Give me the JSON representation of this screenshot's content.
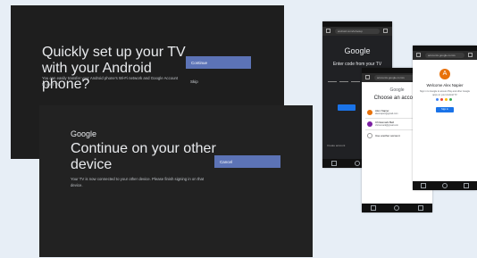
{
  "tv_setup": {
    "title": "Quickly set up your TV with your Android phone?",
    "description": "You can easily transfer your Android phone's Wi-Fi network and Google Account to your TV",
    "continue_label": "Continue",
    "skip_label": "Skip"
  },
  "tv_continue": {
    "brand": "Google",
    "title": "Continue on your other device",
    "description": "Your TV is now connected to your other device. Please finish signing in on that device.",
    "cancel_label": "Cancel"
  },
  "phone_code": {
    "url": "android.com/tv/setup",
    "brand": "Google",
    "label": "Enter code from your TV",
    "footer": "Create account"
  },
  "phone_accounts": {
    "url": "accounts.google.com/o",
    "brand": "Google",
    "title": "Choose an account",
    "accounts": [
      {
        "name": "Alex Napier",
        "email": "alexnapier@gmail.com"
      },
      {
        "name": "Chrissmark Bell",
        "email": "chrissmark@gmail.com"
      },
      {
        "name": "Use another account",
        "email": ""
      }
    ]
  },
  "phone_welcome": {
    "url": "accounts.google.com/o",
    "avatar_letter": "A",
    "welcome": "Welcome Alex Napier",
    "description": "Sign in to Google to access Play and other Google apps on your Android TV",
    "signin_label": "Sign in"
  },
  "colors": {
    "accent": "#5c73b6",
    "google_blue": "#1a73e8",
    "avatar_orange": "#e8710a"
  }
}
